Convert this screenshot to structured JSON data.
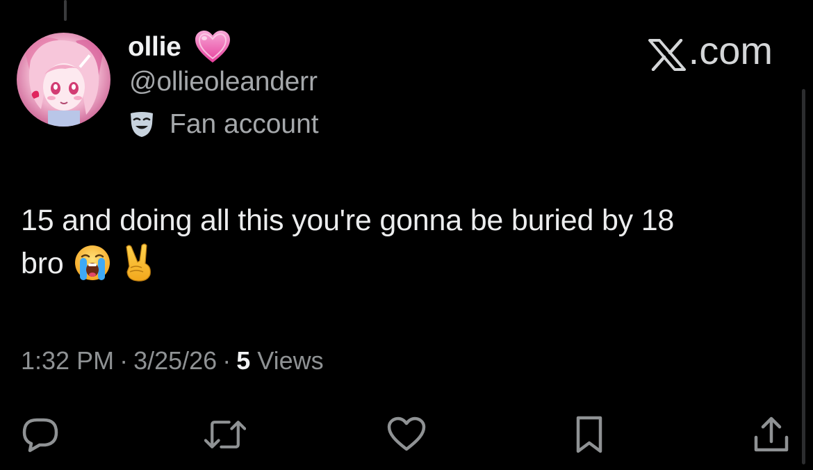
{
  "post": {
    "author": {
      "display_name": "ollie",
      "name_emoji": "pink-heart-icon",
      "handle": "@ollieoleanderr",
      "badge_icon": "theater-mask-icon",
      "badge_label": "Fan account"
    },
    "brand": {
      "logo_icon": "x-logo-icon",
      "label": ".com"
    },
    "text_line_1": "15 and doing all this you're gonna be buried by 18",
    "text_line_2": "bro",
    "text_emojis": [
      "loudly-crying-face-icon",
      "victory-hand-icon"
    ],
    "meta": {
      "time": "1:32 PM",
      "separator": "·",
      "date": "3/25/26",
      "views_count": "5",
      "views_label": "Views"
    },
    "actions": [
      {
        "name": "reply-icon"
      },
      {
        "name": "repost-icon"
      },
      {
        "name": "like-icon"
      },
      {
        "name": "bookmark-icon"
      },
      {
        "name": "share-icon"
      }
    ]
  },
  "colors": {
    "background": "#000000",
    "primary_text": "#e7e9ea",
    "secondary_text": "#a5a8ab",
    "muted_text": "#8f9294",
    "icon": "#8f9294"
  }
}
